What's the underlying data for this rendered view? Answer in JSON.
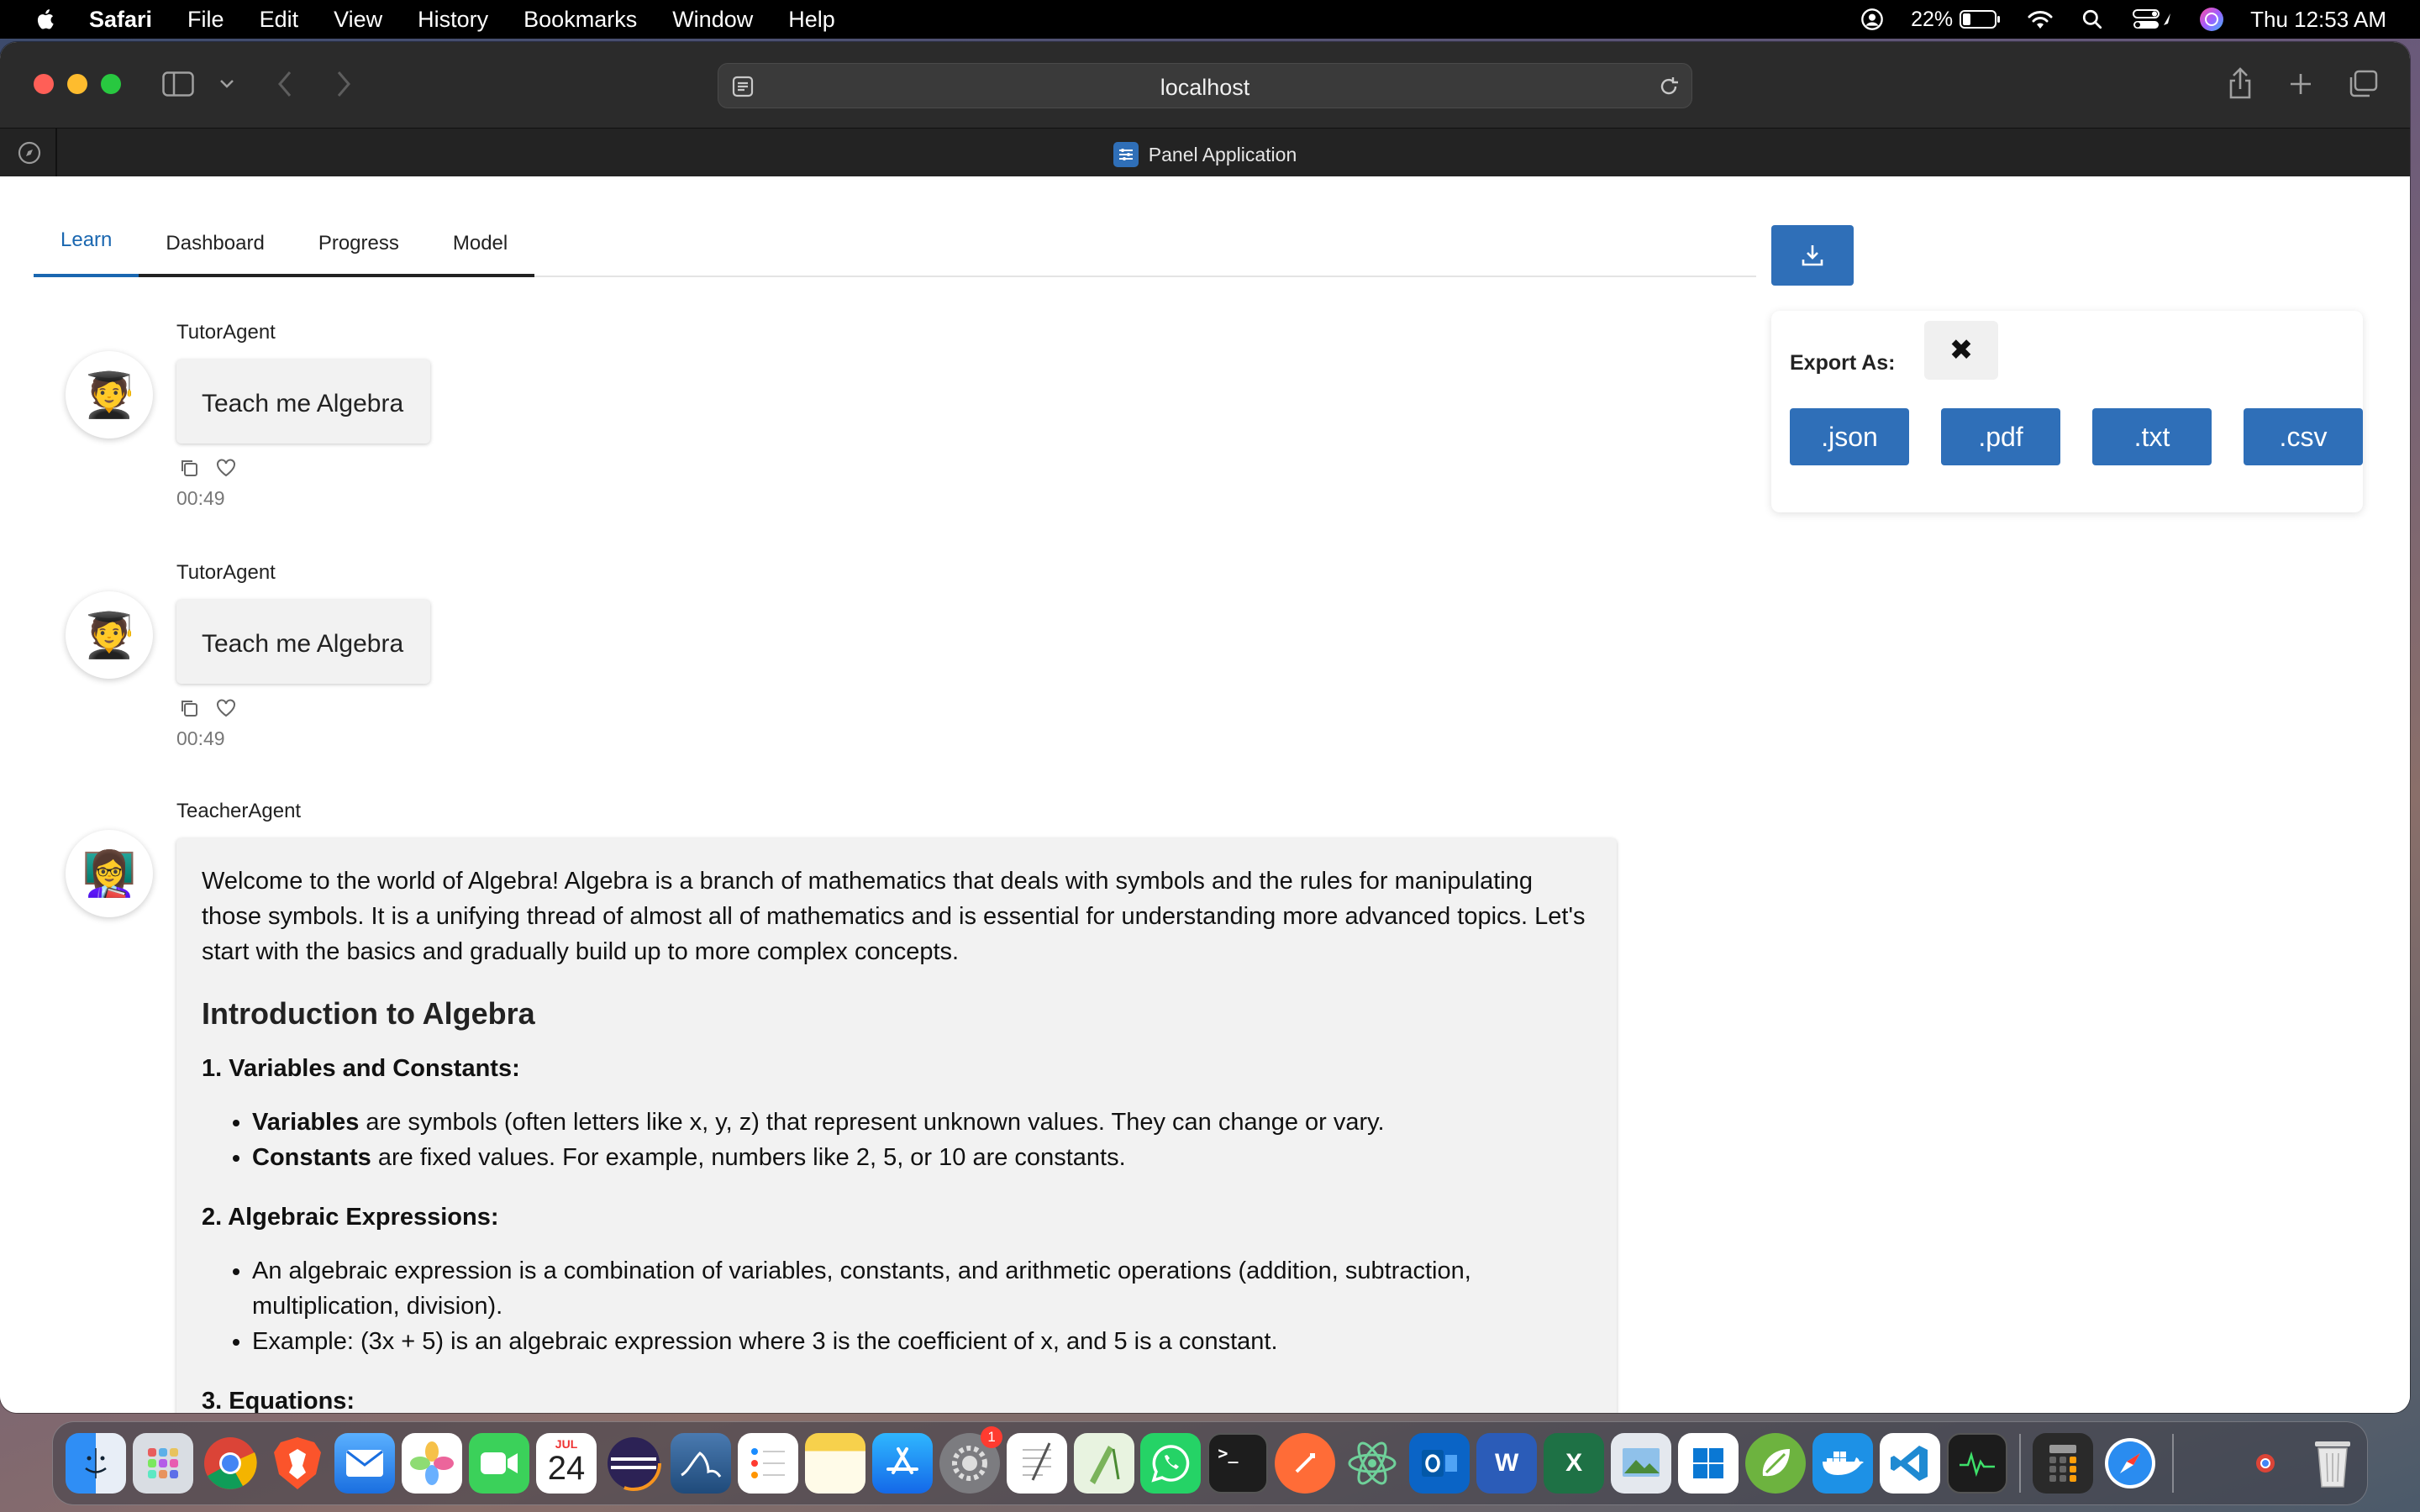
{
  "menubar": {
    "app": "Safari",
    "items": [
      "File",
      "Edit",
      "View",
      "History",
      "Bookmarks",
      "Window",
      "Help"
    ],
    "battery": "22%",
    "clock": "Thu 12:53 AM"
  },
  "browser": {
    "url": "localhost",
    "tab_title": "Panel Application"
  },
  "app": {
    "tabs": [
      "Learn",
      "Dashboard",
      "Progress",
      "Model"
    ],
    "active_tab": "Learn",
    "export": {
      "label": "Export As:",
      "close_glyph": "✖",
      "formats": [
        ".json",
        ".pdf",
        ".txt",
        ".csv"
      ]
    },
    "messages": [
      {
        "author": "TutorAgent",
        "avatar": "🧑‍🎓",
        "text": "Teach me Algebra",
        "time": "00:49"
      },
      {
        "author": "TutorAgent",
        "avatar": "🧑‍🎓",
        "text": "Teach me Algebra",
        "time": "00:49"
      }
    ],
    "teacher": {
      "author": "TeacherAgent",
      "avatar": "👩‍🏫",
      "intro": "Welcome to the world of Algebra! Algebra is a branch of mathematics that deals with symbols and the rules for manipulating those symbols. It is a unifying thread of almost all of mathematics and is essential for understanding more advanced topics. Let's start with the basics and gradually build up to more complex concepts.",
      "heading": "Introduction to Algebra",
      "s1_title": "1. Variables and Constants:",
      "s1_b1_bold": "Variables",
      "s1_b1_text": " are symbols (often letters like x, y, z) that represent unknown values. They can change or vary.",
      "s1_b2_bold": "Constants",
      "s1_b2_text": " are fixed values. For example, numbers like 2, 5, or 10 are constants.",
      "s2_title": "2. Algebraic Expressions:",
      "s2_b1": "An algebraic expression is a combination of variables, constants, and arithmetic operations (addition, subtraction, multiplication, division).",
      "s2_b2": "Example: (3x + 5) is an algebraic expression where 3 is the coefficient of x, and 5 is a constant.",
      "s3_title": "3. Equations:"
    }
  },
  "dock": {
    "calendar_month": "JUL",
    "calendar_day": "24",
    "settings_badge": "1",
    "apps": [
      "finder-icon",
      "launchpad-icon",
      "chrome-icon",
      "brave-icon",
      "mail-icon",
      "photos-icon",
      "facetime-icon",
      "calendar-icon",
      "eclipse-icon",
      "mysql-workbench-icon",
      "reminders-icon",
      "notes-icon",
      "app-store-icon",
      "system-settings-icon",
      "textedit-icon",
      "scripteditor-icon",
      "whatsapp-icon",
      "terminal-icon",
      "postman-icon",
      "atom-icon",
      "outlook-icon",
      "word-icon",
      "excel-icon",
      "preview-icon",
      "windows-app-icon",
      "spring-icon",
      "docker-icon",
      "vscode-icon",
      "activity-monitor-icon",
      "calculator-icon",
      "safari-icon",
      "trash-icon"
    ]
  }
}
